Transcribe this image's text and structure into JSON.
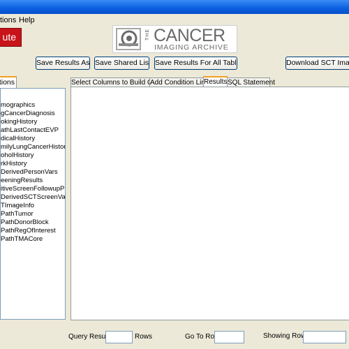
{
  "menu": {
    "items": [
      {
        "label": "tions"
      },
      {
        "label": "Help"
      }
    ]
  },
  "toolbar": {
    "run_label": "ute",
    "save_results_as": "Save Results As",
    "save_shared_list": "Save Shared List",
    "save_results_all": "Save Results For All Tables",
    "download_images": "Download SCT Images"
  },
  "logo": {
    "the": "THE",
    "big": "CANCER",
    "small": "IMAGING ARCHIVE"
  },
  "left_panel": {
    "tab_label": "tions",
    "items": [
      "mographics",
      "gCancerDiagnosis",
      "okingHistory",
      "athLastContactEVP",
      "dicalHistory",
      "milyLungCancerHistory",
      "oholHistory",
      "rkHistory",
      "DerivedPersonVars",
      "eeningResults",
      "itiveScreenFollowupProcs",
      "DerivedSCTScreenVars",
      "TImageInfo",
      "PathTumor",
      "PathDonorBlock",
      "PathRegOfInterest",
      "PathTMACore"
    ]
  },
  "tabs": [
    {
      "label": "Select Columns to Build Query"
    },
    {
      "label": "Add Condition Limits"
    },
    {
      "label": "Results"
    },
    {
      "label": "SQL Statement"
    }
  ],
  "status": {
    "query_results_label": "Query Results",
    "query_results_value": "",
    "rows_label": "Rows",
    "go_to_row_label": "Go To Row",
    "go_to_row_value": "",
    "showing_rows_label": "Showing Rows:",
    "showing_rows_value": ""
  },
  "colors": {
    "accent": "#c8131a",
    "tab_highlight": "#f0a020",
    "titlebar": "#0a5fe0"
  }
}
